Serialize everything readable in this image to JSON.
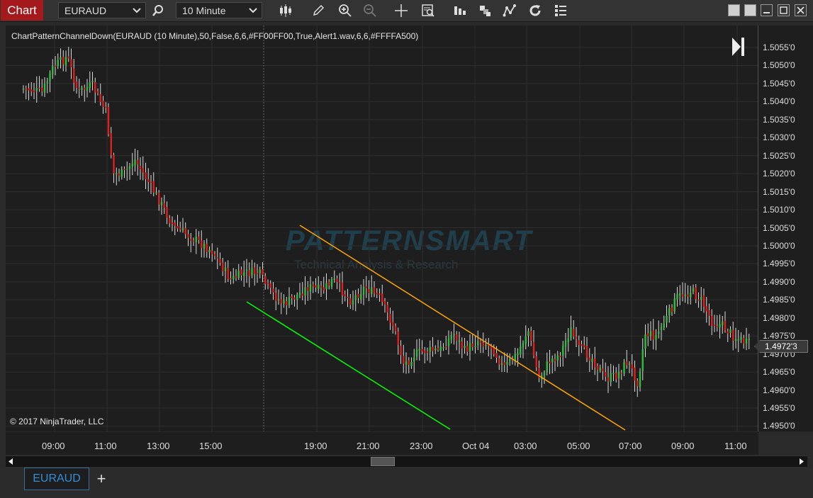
{
  "toolbar": {
    "chart_tab": "Chart",
    "instrument": "EURAUD",
    "interval": "10 Minute",
    "icons": [
      "search-icon",
      "bars-type-icon",
      "pencil-icon",
      "zoom-in-icon",
      "zoom-out-icon",
      "crosshair-icon",
      "data-box-icon",
      "trade-icon",
      "templates-icon",
      "strategies-icon",
      "reload-icon",
      "properties-icon"
    ]
  },
  "indicator_label": "ChartPatternChannelDown(EURAUD (10 Minute),50,False,6,6,#FF00FF00,True,Alert1.wav,6,6,#FFFFA500)",
  "watermark": {
    "title": "PATTERNSMART",
    "subtitle": "Technical Analysis & Research"
  },
  "copyright": "© 2017 NinjaTrader, LLC",
  "current_price": "1.4972'3",
  "price_axis": [
    "1.5055'0",
    "1.5050'0",
    "1.5045'0",
    "1.5040'0",
    "1.5035'0",
    "1.5030'0",
    "1.5025'0",
    "1.5020'0",
    "1.5015'0",
    "1.5010'0",
    "1.5005'0",
    "1.5000'0",
    "1.4995'0",
    "1.4990'0",
    "1.4985'0",
    "1.4980'0",
    "1.4975'0",
    "1.4970'0",
    "1.4965'0",
    "1.4960'0",
    "1.4955'0",
    "1.4950'0"
  ],
  "time_axis": [
    "09:00",
    "11:00",
    "13:00",
    "15:00",
    "19:00",
    "21:00",
    "23:00",
    "Oct 04",
    "03:00",
    "05:00",
    "07:00",
    "09:00",
    "11:00"
  ],
  "tabs": {
    "instrument_tab": "EURAUD",
    "add_tab": "+"
  },
  "colors": {
    "up": "#2fbf3f",
    "down": "#e0201c",
    "wick": "#d8d8d8",
    "upper_line": "#ffa500",
    "lower_line": "#00ff00",
    "chart_tab": "#a3191c"
  }
}
